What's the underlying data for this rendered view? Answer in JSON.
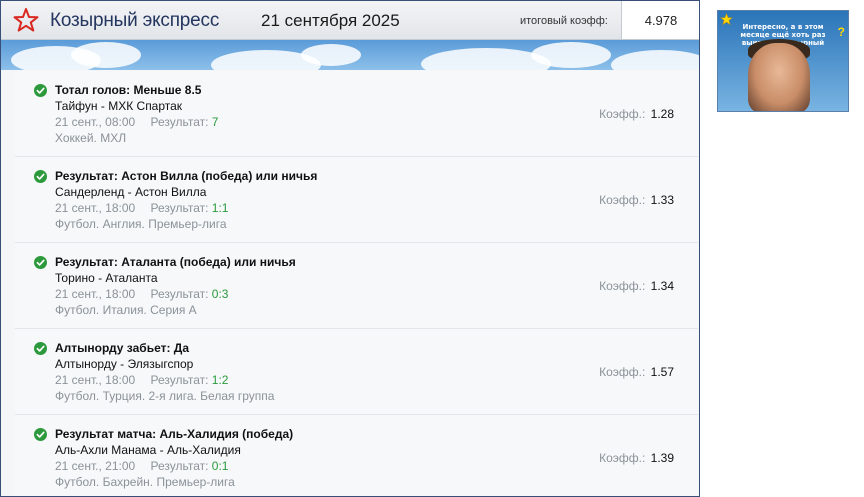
{
  "header": {
    "brand": "Козырный экспресс",
    "date": "21 сентября 2025",
    "total_label": "итоговый коэфф:",
    "total_value": "4.978",
    "star_color": "#d9281f"
  },
  "bets": [
    {
      "title": "Тотал голов: Меньше 8.5",
      "teams": "Тайфун - МХК Спартак",
      "time": "21 сент., 08:00",
      "result_label": "Результат:",
      "result": "7",
      "league": "Хоккей. МХЛ",
      "odds_label": "Коэфф.:",
      "odds": "1.28",
      "status_icon": "check-circle-icon"
    },
    {
      "title": "Результат: Астон Вилла (победа) или ничья",
      "teams": "Сандерленд - Астон Вилла",
      "time": "21 сент., 18:00",
      "result_label": "Результат:",
      "result": "1:1",
      "league": "Футбол. Англия. Премьер-лига",
      "odds_label": "Коэфф.:",
      "odds": "1.33",
      "status_icon": "check-circle-icon"
    },
    {
      "title": "Результат: Аталанта (победа) или ничья",
      "teams": "Торино - Аталанта",
      "time": "21 сент., 18:00",
      "result_label": "Результат:",
      "result": "0:3",
      "league": "Футбол. Италия. Серия А",
      "odds_label": "Коэфф.:",
      "odds": "1.34",
      "status_icon": "check-circle-icon"
    },
    {
      "title": "Алтынорду забьет: Да",
      "teams": "Алтынорду - Элязыгспор",
      "time": "21 сент., 18:00",
      "result_label": "Результат:",
      "result": "1:2",
      "league": "Футбол. Турция. 2-я лига. Белая группа",
      "odds_label": "Коэфф.:",
      "odds": "1.57",
      "status_icon": "check-circle-icon"
    },
    {
      "title": "Результат матча: Аль-Халидия (победа)",
      "teams": "Аль-Ахли Манама - Аль-Халидия",
      "time": "21 сент., 21:00",
      "result_label": "Результат:",
      "result": "0:1",
      "league": "Футбол. Бахрейн. Премьер-лига",
      "odds_label": "Коэфф.:",
      "odds": "1.39",
      "status_icon": "check-circle-icon"
    }
  ],
  "ad": {
    "caption": "Интересно, а в этом месяце ещё хоть раз выиграет Козырный экспресс",
    "question_mark": "?",
    "icon": "star-icon"
  },
  "colors": {
    "win_green": "#2c9a3c",
    "brand_blue": "#24365f",
    "frame_border": "#3a4f78"
  }
}
